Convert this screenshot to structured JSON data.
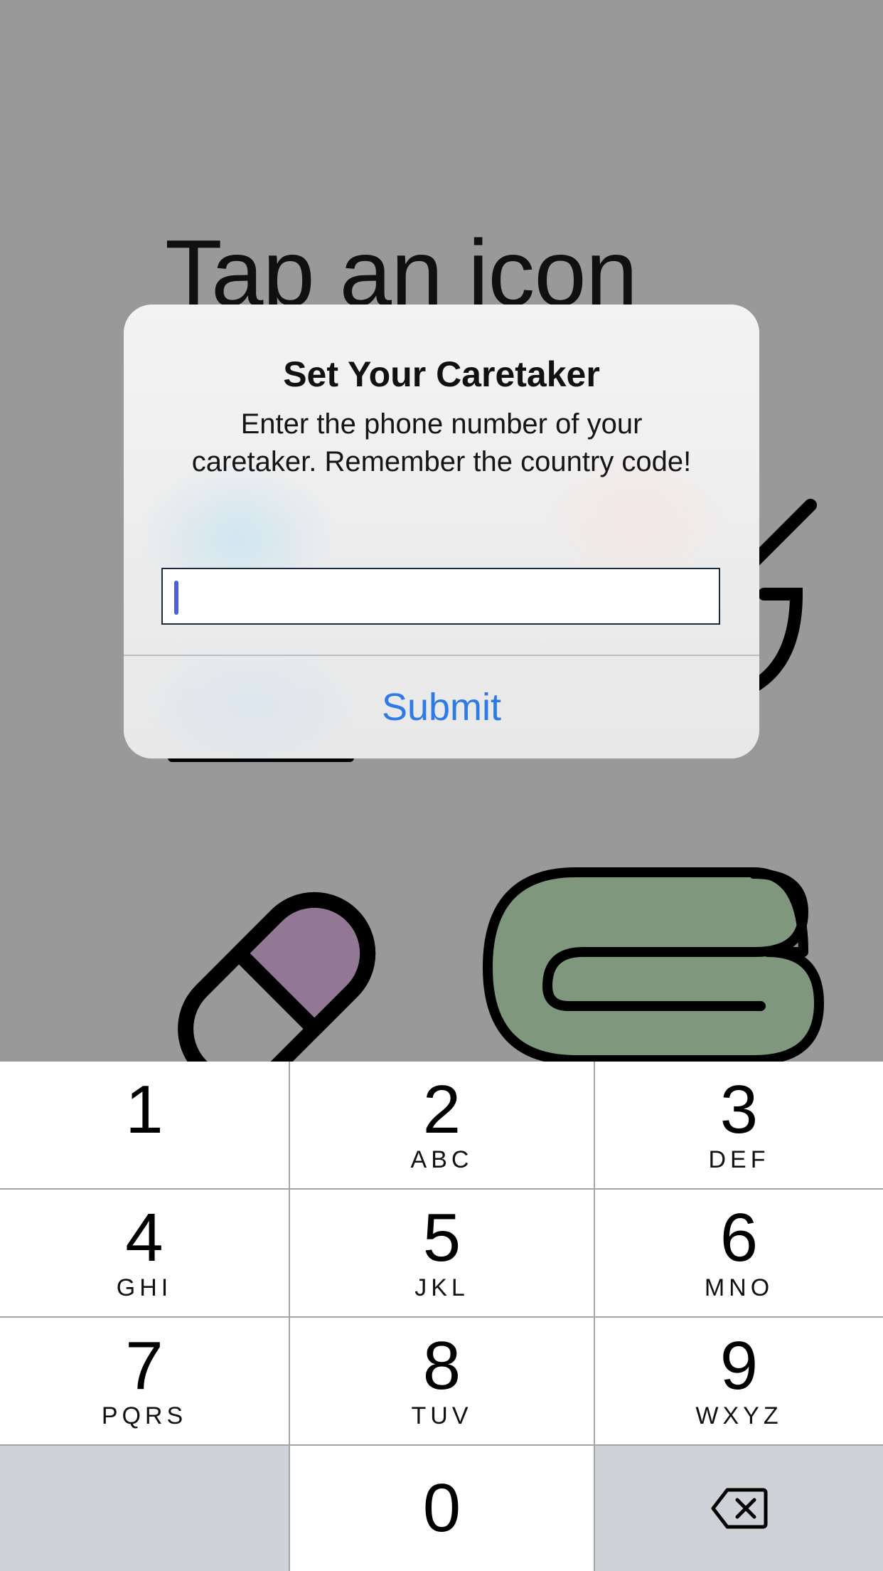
{
  "background_app": {
    "headline": "Tap an icon",
    "icons": [
      "bowl-icon",
      "pill-icon",
      "blanket-icon"
    ]
  },
  "alert": {
    "title": "Set Your Caretaker",
    "message": "Enter the phone number of your caretaker. Remember the country code!",
    "input_value": "",
    "input_placeholder": "",
    "submit_label": "Submit"
  },
  "keypad": {
    "keys": [
      {
        "digit": "1",
        "letters": ""
      },
      {
        "digit": "2",
        "letters": "ABC"
      },
      {
        "digit": "3",
        "letters": "DEF"
      },
      {
        "digit": "4",
        "letters": "GHI"
      },
      {
        "digit": "5",
        "letters": "JKL"
      },
      {
        "digit": "6",
        "letters": "MNO"
      },
      {
        "digit": "7",
        "letters": "PQRS"
      },
      {
        "digit": "8",
        "letters": "TUV"
      },
      {
        "digit": "9",
        "letters": "WXYZ"
      },
      {
        "digit": "0",
        "letters": ""
      }
    ],
    "delete_icon": "backspace-icon"
  },
  "colors": {
    "dim_background": "#999999",
    "alert_tint": "#ececec",
    "link_blue": "#2e7ae6",
    "pill_purple": "#937896",
    "blanket_green": "#7f977d",
    "keypad_dark_key": "#cfd3d8"
  }
}
